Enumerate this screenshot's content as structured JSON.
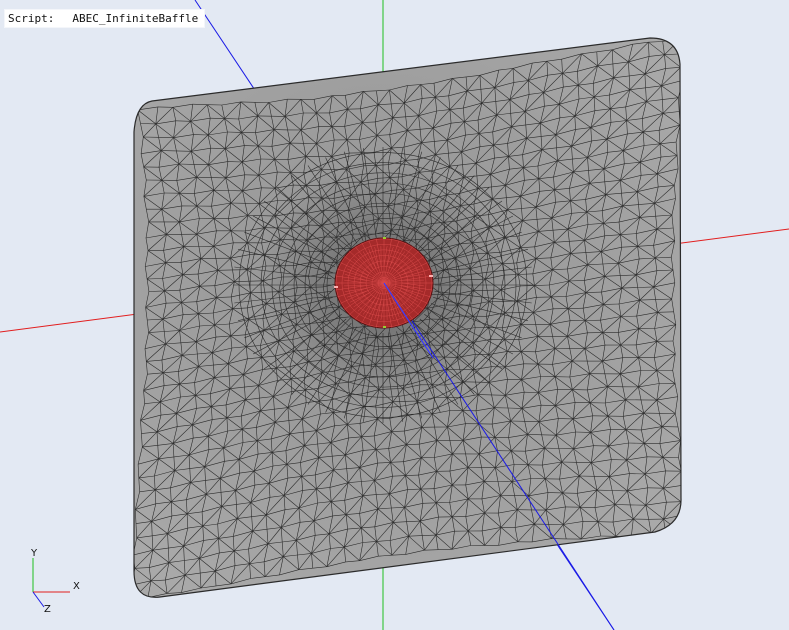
{
  "overlay": {
    "script_key": "Script:",
    "script_value": "ABEC_InfiniteBaffle"
  },
  "triad": {
    "x_label": "X",
    "y_label": "Y",
    "z_label": "Z"
  },
  "colors": {
    "background": "#e3e9f3",
    "baffle_fill": "#a9a9a9",
    "mesh_line": "#2b2b2b",
    "driver_fill": "#a52a2a",
    "driver_mesh": "#d84a4a",
    "axis_x": "#e21e1e",
    "axis_y": "#1fbf1f",
    "axis_z": "#1a1ae6"
  }
}
